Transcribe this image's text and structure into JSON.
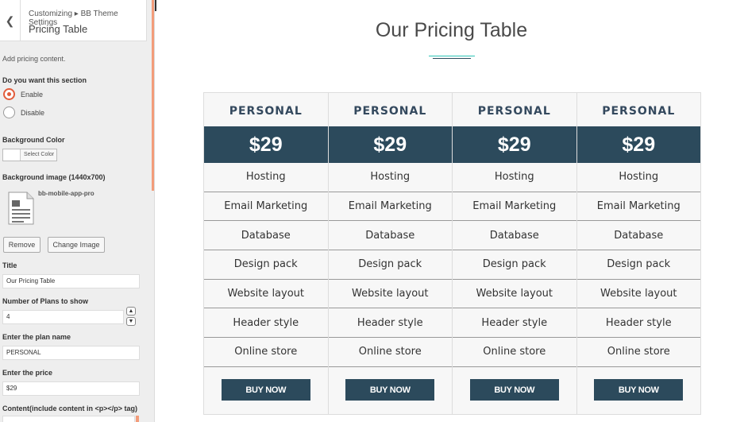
{
  "sidebar": {
    "breadcrumb": "Customizing ▸ BB Theme Settings",
    "section_title": "Pricing Table",
    "description": "Add pricing content.",
    "enable_question": "Do you want this section",
    "enable_label": "Enable",
    "disable_label": "Disable",
    "selected_option": "Enable",
    "bg_color_label": "Background Color",
    "select_color_label": "Select Color",
    "bg_image_label": "Background image (1440x700)",
    "image_filename": "bb-mobile-app-pro",
    "remove_label": "Remove",
    "change_image_label": "Change Image",
    "title_label": "Title",
    "title_value": "Our Pricing Table",
    "plans_count_label": "Number of Plans to show",
    "plans_count_value": "4",
    "plan_name_label": "Enter the plan name",
    "plan_name_value": "PERSONAL",
    "price_label": "Enter the price",
    "price_value": "$29",
    "content_label": "Content(include content in <p></p> tag)",
    "accent_color": "#f39c7a"
  },
  "preview": {
    "title": "Our Pricing Table",
    "underline_colors": [
      "#2ec4b6",
      "#2c4a5c"
    ],
    "plans": [
      {
        "name": "PERSONAL",
        "price": "$29",
        "features": [
          "Hosting",
          "Email Marketing",
          "Database",
          "Design pack",
          "Website layout",
          "Header style",
          "Online store"
        ],
        "button": "BUY NOW"
      },
      {
        "name": "PERSONAL",
        "price": "$29",
        "features": [
          "Hosting",
          "Email Marketing",
          "Database",
          "Design pack",
          "Website layout",
          "Header style",
          "Online store"
        ],
        "button": "BUY NOW"
      },
      {
        "name": "PERSONAL",
        "price": "$29",
        "features": [
          "Hosting",
          "Email Marketing",
          "Database",
          "Design pack",
          "Website layout",
          "Header style",
          "Online store"
        ],
        "button": "BUY NOW"
      },
      {
        "name": "PERSONAL",
        "price": "$29",
        "features": [
          "Hosting",
          "Email Marketing",
          "Database",
          "Design pack",
          "Website layout",
          "Header style",
          "Online store"
        ],
        "button": "BUY NOW"
      }
    ],
    "brand_color": "#2c4a5c"
  }
}
